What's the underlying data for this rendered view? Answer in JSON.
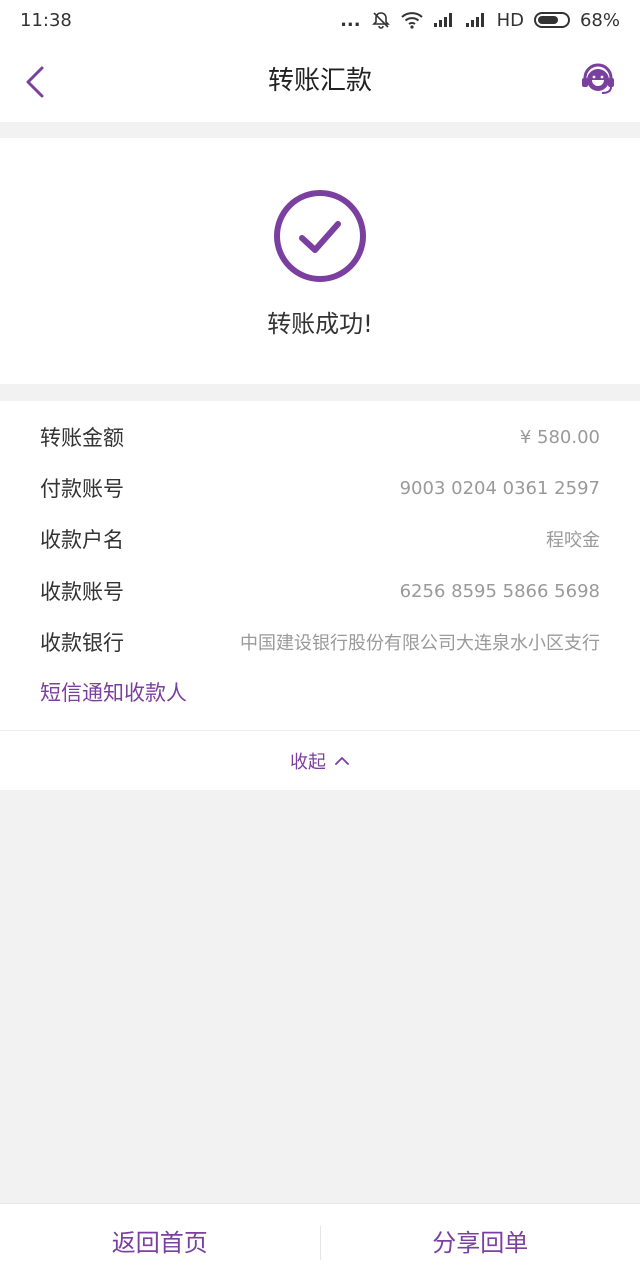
{
  "status_bar": {
    "time": "11:38",
    "dots": "...",
    "network": "HD",
    "battery": "68%",
    "icons": [
      "bell-off-icon",
      "wifi-icon",
      "signal-icon",
      "signal-icon",
      "battery-icon"
    ]
  },
  "nav": {
    "title": "转账汇款",
    "back_icon": "chevron-left-icon",
    "service_icon": "customer-service-icon"
  },
  "result": {
    "icon": "check-circle-icon",
    "message": "转账成功!"
  },
  "details": [
    {
      "label": "转账金额",
      "value": "¥ 580.00"
    },
    {
      "label": "付款账号",
      "value": "9003 0204 0361 2597"
    },
    {
      "label": "收款户名",
      "value": "程咬金"
    },
    {
      "label": "收款账号",
      "value": "6256 8595 5866 5698"
    },
    {
      "label": "收款银行",
      "value": "中国建设银行股份有限公司大连泉水小区支行"
    }
  ],
  "sms_notify": "短信通知收款人",
  "collapse_label": "收起",
  "bottom": {
    "home_label": "返回首页",
    "share_label": "分享回单"
  },
  "colors": {
    "accent": "#7b3fa0",
    "background": "#f2f2f2",
    "card": "#ffffff",
    "text": "#333333",
    "muted": "#9a9a9a"
  }
}
